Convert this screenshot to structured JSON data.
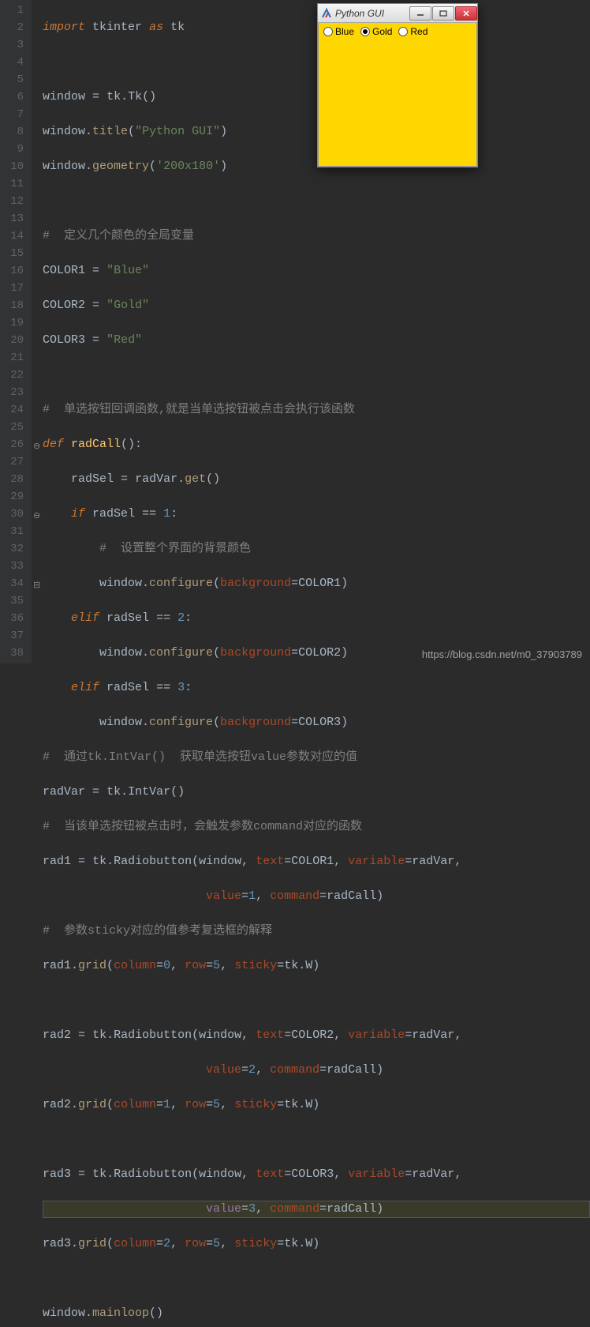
{
  "gui_window": {
    "title": "Python GUI",
    "radios": [
      {
        "label": "Blue",
        "selected": false
      },
      {
        "label": "Gold",
        "selected": true
      },
      {
        "label": "Red",
        "selected": false
      }
    ]
  },
  "watermark": "https://blog.csdn.net/m0_37903789",
  "line_numbers": [
    "1",
    "2",
    "3",
    "4",
    "5",
    "6",
    "7",
    "8",
    "9",
    "10",
    "11",
    "12",
    "13",
    "14",
    "15",
    "16",
    "17",
    "18",
    "19",
    "20",
    "21",
    "22",
    "23",
    "24",
    "25",
    "26",
    "27",
    "28",
    "29",
    "30",
    "31",
    "32",
    "33",
    "34",
    "35",
    "36",
    "37",
    "38"
  ],
  "code": {
    "l1": {
      "t1": "import",
      "t2": "tkinter",
      "t3": "as",
      "t4": "tk"
    },
    "l3": {
      "t1": "window",
      "t2": "=",
      "t3": "tk",
      "t4": ".",
      "t5": "Tk",
      "t6": "()"
    },
    "l4": {
      "t1": "window",
      "t2": ".",
      "t3": "title",
      "t4": "(",
      "t5": "\"Python GUI\"",
      "t6": ")"
    },
    "l5": {
      "t1": "window",
      "t2": ".",
      "t3": "geometry",
      "t4": "(",
      "t5": "'200x180'",
      "t6": ")"
    },
    "l7": {
      "t1": "#  定义几个颜色的全局变量"
    },
    "l8": {
      "t1": "COLOR1",
      "t2": "=",
      "t3": "\"Blue\""
    },
    "l9": {
      "t1": "COLOR2",
      "t2": "=",
      "t3": "\"Gold\""
    },
    "l10": {
      "t1": "COLOR3",
      "t2": "=",
      "t3": "\"Red\""
    },
    "l12": {
      "t1": "#  单选按钮回调函数,就是当单选按钮被点击会执行该函数"
    },
    "l13": {
      "t1": "def",
      "t2": "radCall",
      "t3": "():"
    },
    "l14": {
      "t1": "radSel",
      "t2": "=",
      "t3": "radVar",
      "t4": ".",
      "t5": "get",
      "t6": "()"
    },
    "l15": {
      "t1": "if",
      "t2": "radSel",
      "t3": "==",
      "t4": "1",
      "t5": ":"
    },
    "l16": {
      "t1": "#  设置整个界面的背景颜色"
    },
    "l17": {
      "t1": "window",
      "t2": ".",
      "t3": "configure",
      "t4": "(",
      "t5": "background",
      "t6": "=",
      "t7": "COLOR1",
      "t8": ")"
    },
    "l18": {
      "t1": "elif",
      "t2": "radSel",
      "t3": "==",
      "t4": "2",
      "t5": ":"
    },
    "l19": {
      "t1": "window",
      "t2": ".",
      "t3": "configure",
      "t4": "(",
      "t5": "background",
      "t6": "=",
      "t7": "COLOR2",
      "t8": ")"
    },
    "l20": {
      "t1": "elif",
      "t2": "radSel",
      "t3": "==",
      "t4": "3",
      "t5": ":"
    },
    "l21": {
      "t1": "window",
      "t2": ".",
      "t3": "configure",
      "t4": "(",
      "t5": "background",
      "t6": "=",
      "t7": "COLOR3",
      "t8": ")"
    },
    "l22": {
      "t1": "#  通过tk.IntVar()  获取单选按钮value参数对应的值"
    },
    "l23": {
      "t1": "radVar",
      "t2": "=",
      "t3": "tk",
      "t4": ".",
      "t5": "IntVar",
      "t6": "()"
    },
    "l24": {
      "t1": "#  当该单选按钮被点击时，会触发参数command对应的函数"
    },
    "l25": {
      "t1": "rad1",
      "t2": "=",
      "t3": "tk",
      "t4": ".",
      "t5": "Radiobutton",
      "t6": "(",
      "t7": "window",
      "t8": ",",
      "t9": "text",
      "t10": "=",
      "t11": "COLOR1",
      "t12": ",",
      "t13": "variable",
      "t14": "=",
      "t15": "radVar",
      "t16": ","
    },
    "l26": {
      "t1": "value",
      "t2": "=",
      "t3": "1",
      "t4": ",",
      "t5": "command",
      "t6": "=",
      "t7": "radCall",
      "t8": ")"
    },
    "l27": {
      "t1": "#  参数sticky对应的值参考复选框的解释"
    },
    "l28": {
      "t1": "rad1",
      "t2": ".",
      "t3": "grid",
      "t4": "(",
      "t5": "column",
      "t6": "=",
      "t7": "0",
      "t8": ",",
      "t9": "row",
      "t10": "=",
      "t11": "5",
      "t12": ",",
      "t13": "sticky",
      "t14": "=",
      "t15": "tk",
      "t16": ".",
      "t17": "W",
      "t18": ")"
    },
    "l30": {
      "t1": "rad2",
      "t2": "=",
      "t3": "tk",
      "t4": ".",
      "t5": "Radiobutton",
      "t6": "(",
      "t7": "window",
      "t8": ",",
      "t9": "text",
      "t10": "=",
      "t11": "COLOR2",
      "t12": ",",
      "t13": "variable",
      "t14": "=",
      "t15": "radVar",
      "t16": ","
    },
    "l31": {
      "t1": "value",
      "t2": "=",
      "t3": "2",
      "t4": ",",
      "t5": "command",
      "t6": "=",
      "t7": "radCall",
      "t8": ")"
    },
    "l32": {
      "t1": "rad2",
      "t2": ".",
      "t3": "grid",
      "t4": "(",
      "t5": "column",
      "t6": "=",
      "t7": "1",
      "t8": ",",
      "t9": "row",
      "t10": "=",
      "t11": "5",
      "t12": ",",
      "t13": "sticky",
      "t14": "=",
      "t15": "tk",
      "t16": ".",
      "t17": "W",
      "t18": ")"
    },
    "l34": {
      "t1": "rad3",
      "t2": "=",
      "t3": "tk",
      "t4": ".",
      "t5": "Radiobutton",
      "t6": "(",
      "t7": "window",
      "t8": ",",
      "t9": "text",
      "t10": "=",
      "t11": "COLOR3",
      "t12": ",",
      "t13": "variable",
      "t14": "=",
      "t15": "radVar",
      "t16": ","
    },
    "l35": {
      "t1": "value",
      "t2": "=",
      "t3": "3",
      "t4": ",",
      "t5": "command",
      "t6": "=",
      "t7": "radCall",
      "t8": ")"
    },
    "l36": {
      "t1": "rad3",
      "t2": ".",
      "t3": "grid",
      "t4": "(",
      "t5": "column",
      "t6": "=",
      "t7": "2",
      "t8": ",",
      "t9": "row",
      "t10": "=",
      "t11": "5",
      "t12": ",",
      "t13": "sticky",
      "t14": "=",
      "t15": "tk",
      "t16": ".",
      "t17": "W",
      "t18": ")"
    },
    "l38": {
      "t1": "window",
      "t2": ".",
      "t3": "mainloop",
      "t4": "()"
    }
  }
}
